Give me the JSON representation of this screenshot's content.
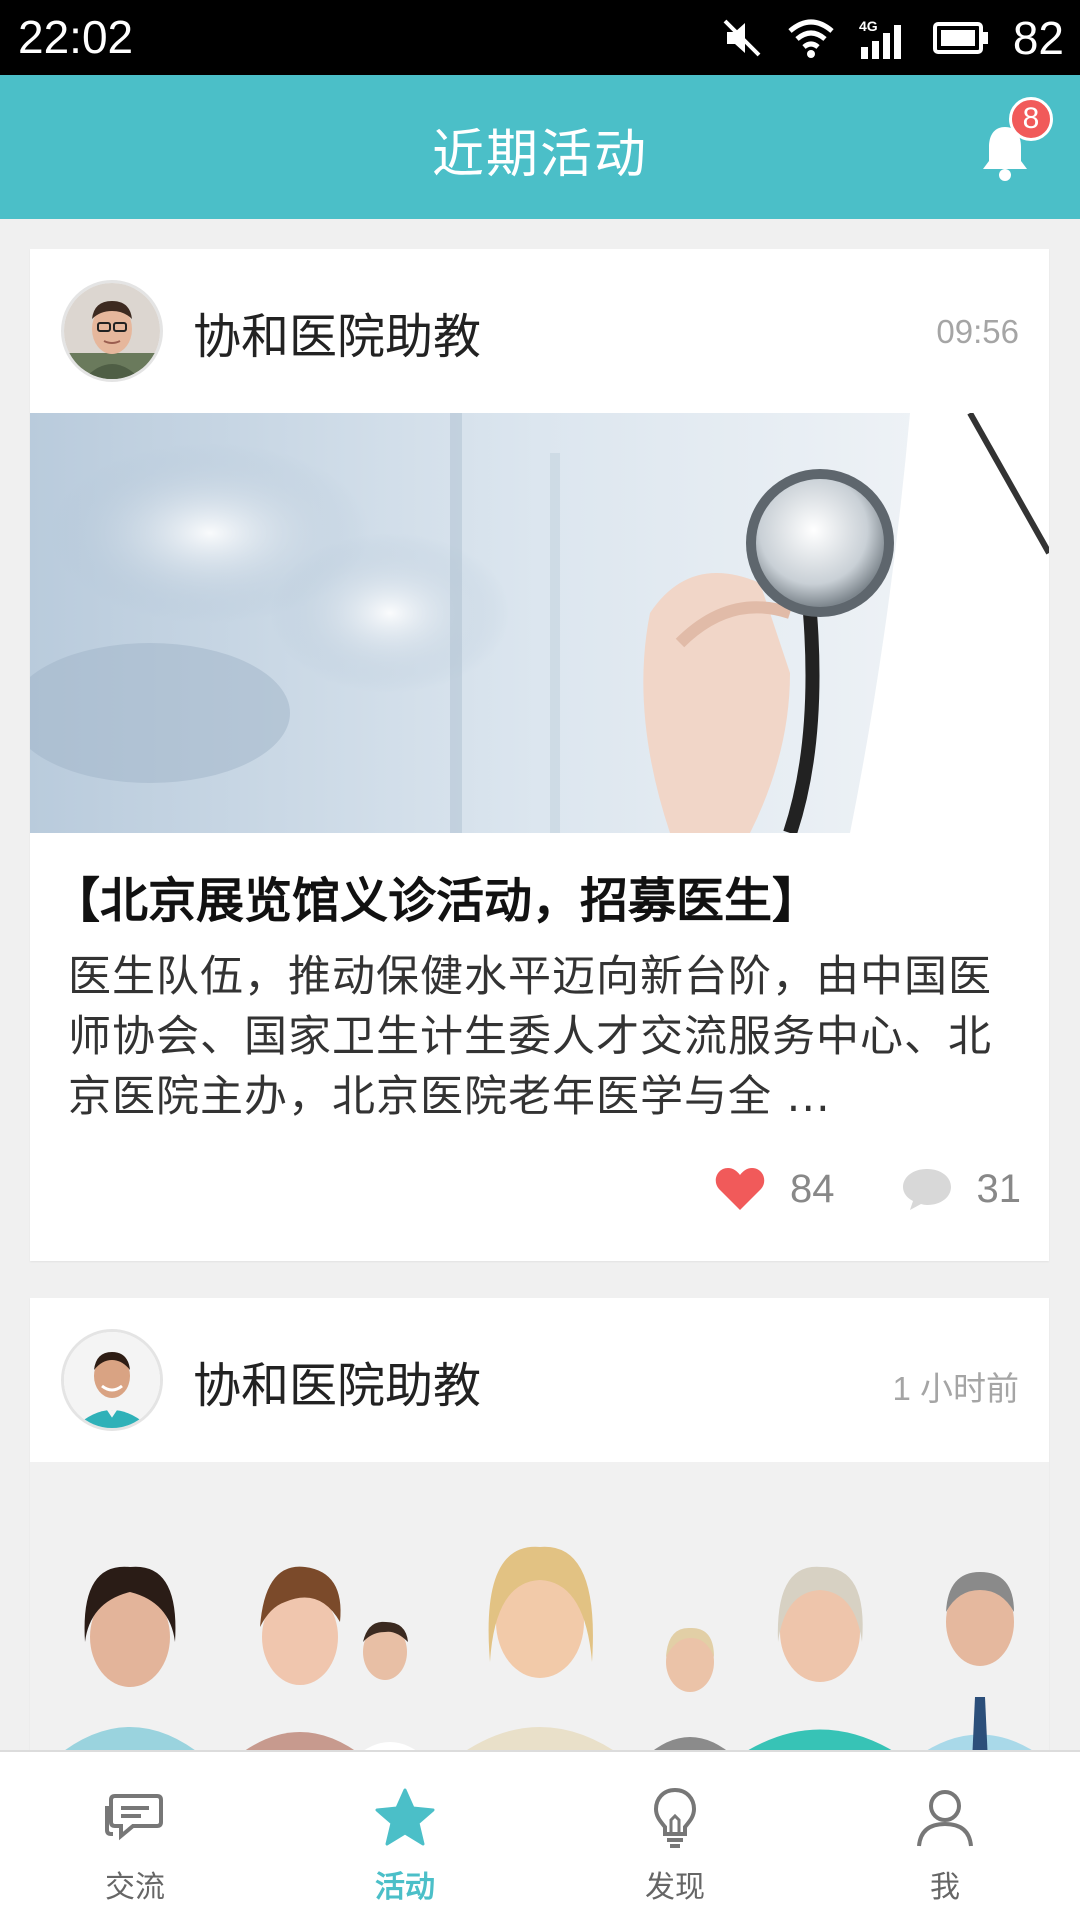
{
  "status_bar": {
    "time": "22:02",
    "battery": "82",
    "icons": [
      "mute-icon",
      "wifi-icon",
      "4g-signal-icon",
      "battery-icon"
    ]
  },
  "header": {
    "title": "近期活动",
    "notification_count": "8"
  },
  "colors": {
    "accent": "#4bbfc8",
    "badge": "#f15a5a",
    "heart": "#f15a5a"
  },
  "posts": [
    {
      "author": "协和医院助教",
      "time": "09:56",
      "title": "【北京展览馆义诊活动，招募医生】",
      "excerpt": "医生队伍，推动保健水平迈向新台阶，由中国医师协会、国家卫生计生委人才交流服务中心、北京医院主办，北京医院老年医学与全 ...",
      "likes": "84",
      "comments": "31"
    },
    {
      "author": "协和医院助教",
      "time": "1 小时前"
    }
  ],
  "bottom_nav": [
    {
      "label": "交流",
      "icon": "chat-icon",
      "active": false
    },
    {
      "label": "活动",
      "icon": "star-icon",
      "active": true
    },
    {
      "label": "发现",
      "icon": "lightbulb-icon",
      "active": false
    },
    {
      "label": "我",
      "icon": "person-icon",
      "active": false
    }
  ]
}
